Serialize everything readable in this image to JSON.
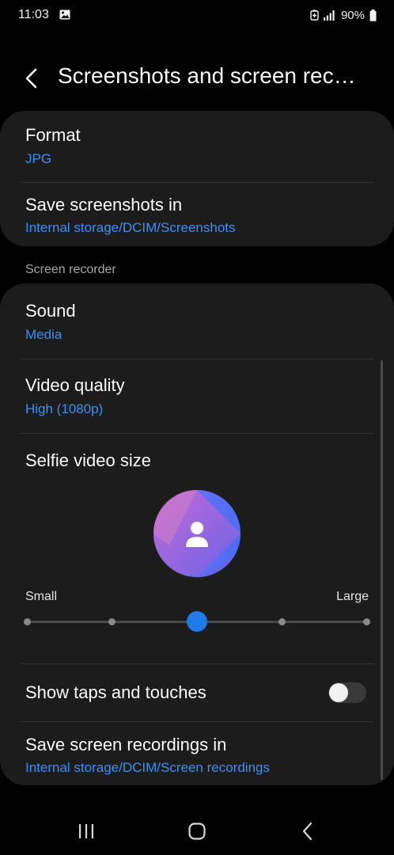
{
  "status_bar": {
    "time": "11:03",
    "battery": "90%",
    "icons": [
      "gallery-icon",
      "battery-saver-icon",
      "signal-icon",
      "battery-icon"
    ]
  },
  "header": {
    "title": "Screenshots and screen rec…",
    "back_icon": "back-arrow-icon"
  },
  "screenshots": {
    "format": {
      "title": "Format",
      "value": "JPG"
    },
    "save_in": {
      "title": "Save screenshots in",
      "value": "Internal storage/DCIM/Screenshots"
    }
  },
  "screen_recorder": {
    "section_label": "Screen recorder",
    "sound": {
      "title": "Sound",
      "value": "Media"
    },
    "video_quality": {
      "title": "Video quality",
      "value": "High (1080p)"
    },
    "selfie_video_size": {
      "title": "Selfie video size",
      "min_label": "Small",
      "max_label": "Large",
      "steps": 5,
      "selected_step": 3
    },
    "show_taps": {
      "title": "Show taps and touches",
      "enabled": false
    },
    "save_recordings_in": {
      "title": "Save screen recordings in",
      "value": "Internal storage/DCIM/Screen recordings"
    }
  },
  "nav_bar": {
    "buttons": [
      "recents-icon",
      "home-icon",
      "back-icon"
    ]
  },
  "colors": {
    "background": "#000000",
    "card": "#1c1c1c",
    "accent_text": "#3e91f2",
    "slider_thumb": "#1f7be8",
    "secondary_text": "#a6a6a6"
  }
}
